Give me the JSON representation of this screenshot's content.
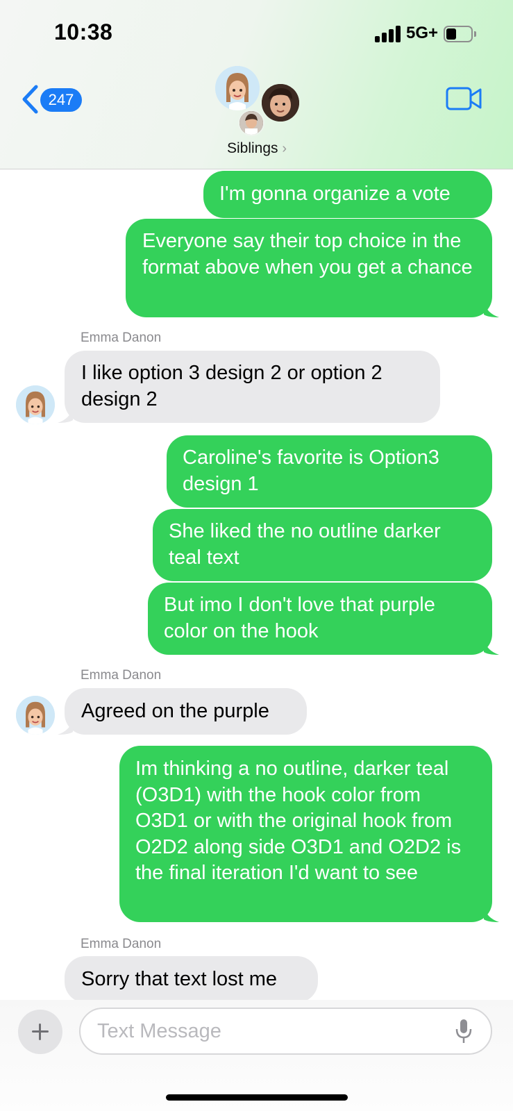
{
  "status_bar": {
    "time": "10:38",
    "network": "5G+"
  },
  "nav": {
    "back_badge": "247",
    "group_name": "Siblings",
    "chevron": "›"
  },
  "messages": [
    {
      "kind": "sent",
      "text": "I'm gonna organize a vote"
    },
    {
      "kind": "sent",
      "text": "Everyone say their top choice in the format above when you get a chance"
    },
    {
      "kind": "recv",
      "sender": "Emma Danon",
      "text": "I like option 3 design 2 or option 2 design 2"
    },
    {
      "kind": "sent",
      "text": "Caroline's favorite is Option3 design 1"
    },
    {
      "kind": "sent",
      "text": "She liked the no outline darker teal text"
    },
    {
      "kind": "sent",
      "text": "But imo I don't love that purple color on the hook"
    },
    {
      "kind": "recv",
      "sender": "Emma Danon",
      "text": "Agreed on the purple"
    },
    {
      "kind": "sent",
      "text": "Im thinking a no outline, darker teal (O3D1) with the hook color from O3D1 or with the original hook from O2D2 along side O3D1 and O2D2 is the final iteration I'd want to see"
    },
    {
      "kind": "recv",
      "sender": "Emma Danon",
      "text": "Sorry that text lost me"
    }
  ],
  "composer": {
    "placeholder": "Text Message"
  },
  "colors": {
    "sent_bubble": "#34d15a",
    "recv_bubble": "#e9e9eb",
    "accent": "#1b7cf6"
  },
  "icons": [
    "back-chevron-icon",
    "video-call-icon",
    "plus-icon",
    "microphone-icon",
    "signal-icon",
    "battery-icon"
  ]
}
